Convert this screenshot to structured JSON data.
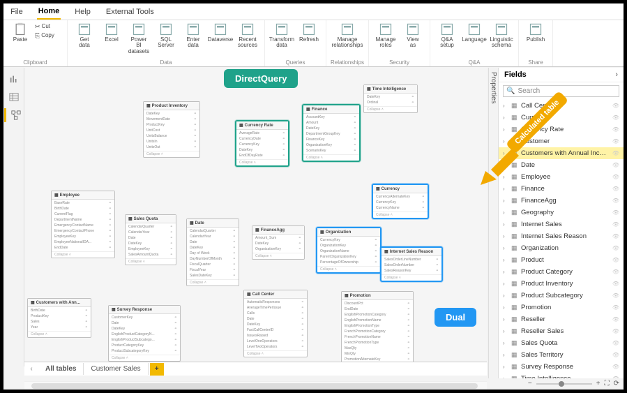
{
  "menu": {
    "items": [
      "File",
      "Home",
      "Help",
      "External Tools"
    ],
    "active": "Home"
  },
  "ribbon": {
    "clipboard": {
      "paste": "Paste",
      "cut": "Cut",
      "copy": "Copy",
      "name": "Clipboard"
    },
    "data": {
      "btns": [
        "Get data",
        "Excel",
        "Power BI datasets",
        "SQL Server",
        "Enter data",
        "Dataverse",
        "Recent sources"
      ],
      "name": "Data"
    },
    "queries": {
      "btns": [
        "Transform data",
        "Refresh"
      ],
      "name": "Queries"
    },
    "relationships": {
      "btns": [
        "Manage relationships"
      ],
      "name": "Relationships"
    },
    "security": {
      "btns": [
        "Manage roles",
        "View as"
      ],
      "name": "Security"
    },
    "qa": {
      "btns": [
        "Q&A setup",
        "Language",
        "Linguistic schema"
      ],
      "name": "Q&A"
    },
    "share": {
      "btns": [
        "Publish"
      ],
      "name": "Share"
    }
  },
  "callouts": {
    "dq": "DirectQuery",
    "dual": "Dual",
    "calc": "Calculated table"
  },
  "tables": {
    "timeIntel": {
      "t": "Time Intelligence",
      "rows": [
        "DateKey",
        "Ordinal"
      ]
    },
    "prodInv": {
      "t": "Product Inventory",
      "rows": [
        "DateKey",
        "MovementDate",
        "ProductKey",
        "UnitCost",
        "UnitsBalance",
        "UnitsIn",
        "UnitsOut"
      ]
    },
    "currencyRate": {
      "t": "Currency Rate",
      "rows": [
        "AverageRate",
        "CurrencyDate",
        "CurrencyKey",
        "DateKey",
        "EndOfDayRate"
      ]
    },
    "finance": {
      "t": "Finance",
      "rows": [
        "AccountKey",
        "Amount",
        "DateKey",
        "DepartmentGroupKey",
        "FinanceKey",
        "OrganizationKey",
        "ScenarioKey"
      ]
    },
    "currency": {
      "t": "Currency",
      "rows": [
        "CurrencyAlternateKey",
        "CurrencyKey",
        "CurrencyName"
      ]
    },
    "employee": {
      "t": "Employee",
      "rows": [
        "BaseRate",
        "BirthDate",
        "CurrentFlag",
        "DepartmentName",
        "EmergencyContactName",
        "EmergencyContactPhone",
        "EmployeeKey",
        "EmployeeNationalIDA...",
        "EndDate"
      ]
    },
    "salesQuota": {
      "t": "Sales Quota",
      "rows": [
        "CalendarQuarter",
        "CalendarYear",
        "Date",
        "DateKey",
        "EmployeeKey",
        "SalesAmountQuota"
      ]
    },
    "date": {
      "t": "Date",
      "rows": [
        "CalendarQuarter",
        "CalendarYear",
        "Date",
        "DateKey",
        "Day of Week",
        "DayNumberOfMonth",
        "FiscalQuarter",
        "FiscalYear",
        "SalesDateKey"
      ]
    },
    "financeAgg": {
      "t": "FinanceAgg",
      "rows": [
        "Amount_Sum",
        "DateKey",
        "OrganizationKey"
      ]
    },
    "organization": {
      "t": "Organization",
      "rows": [
        "CurrencyKey",
        "OrganizationKey",
        "OrganizationName",
        "ParentOrganizationKey",
        "PercentageOfOwnership"
      ]
    },
    "isr": {
      "t": "Internet Sales Reason",
      "rows": [
        "SalesOrderLineNumber",
        "SalesOrderNumber",
        "SalesReasonKey"
      ]
    },
    "custAnnual": {
      "t": "Customers with Ann...",
      "rows": [
        "BirthDate",
        "ProductKey",
        "Sales",
        "Year"
      ]
    },
    "surveyResp": {
      "t": "Survey Response",
      "rows": [
        "CustomerKey",
        "Date",
        "DateKey",
        "EnglishProductCategoryN...",
        "EnglishProductSubcatego...",
        "ProductCategoryKey",
        "ProductSubcategoryKey"
      ]
    },
    "callCenter": {
      "t": "Call Center",
      "rows": [
        "AutomaticResponses",
        "AverageTimePerIssue",
        "Calls",
        "Date",
        "DateKey",
        "FactCallCenterID",
        "IssuesRaised",
        "LevelOneOperators",
        "LevelTwoOperators"
      ]
    },
    "promotion": {
      "t": "Promotion",
      "rows": [
        "DiscountPct",
        "EndDate",
        "EnglishPromotionCategory",
        "EnglishPromotionName",
        "EnglishPromotionType",
        "FrenchPromotionCategory",
        "FrenchPromotionName",
        "FrenchPromotionType",
        "MaxQty",
        "MinQty",
        "PromotionAlternateKey"
      ]
    }
  },
  "fields": {
    "title": "Fields",
    "search": "Search",
    "items": [
      "Call Center",
      "Currency",
      "Currency Rate",
      "Customer",
      "Customers with Annual Income Mor...",
      "Date",
      "Employee",
      "Finance",
      "FinanceAgg",
      "Geography",
      "Internet Sales",
      "Internet Sales Reason",
      "Organization",
      "Product",
      "Product Category",
      "Product Inventory",
      "Product Subcategory",
      "Promotion",
      "Reseller",
      "Reseller Sales",
      "Sales Quota",
      "Sales Territory",
      "Survey Response",
      "Time Intelligence"
    ],
    "highlight": "Customers with Annual Income Mor..."
  },
  "properties": "Properties",
  "tabs": {
    "items": [
      "All tables",
      "Customer Sales"
    ],
    "active": "All tables",
    "add": "+"
  },
  "zoom": {
    "minus": "−",
    "plus": "+",
    "fit": "⛶",
    "pct": "⟳"
  }
}
